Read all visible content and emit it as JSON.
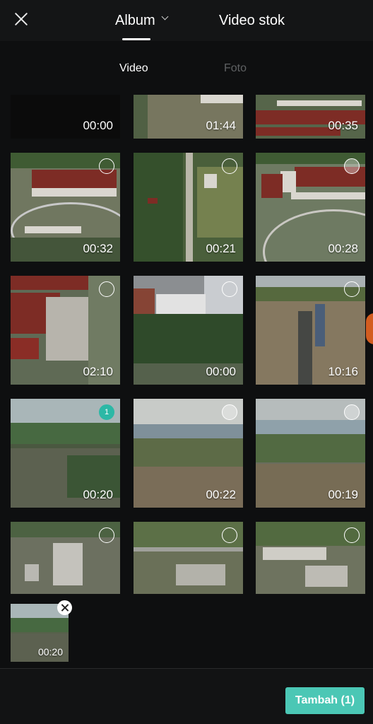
{
  "header": {
    "close_icon": "close-icon",
    "tabs": [
      {
        "label": "Album",
        "active": true,
        "dropdown_icon": "chevron-down-icon"
      },
      {
        "label": "Video stok",
        "active": false
      }
    ]
  },
  "subtabs": [
    {
      "label": "Video",
      "active": true
    },
    {
      "label": "Foto",
      "active": false
    }
  ],
  "grid": {
    "items": [
      {
        "duration": "00:00"
      },
      {
        "duration": "01:44"
      },
      {
        "duration": "00:35"
      },
      {
        "duration": "00:32",
        "selected": false
      },
      {
        "duration": "00:21",
        "selected": false
      },
      {
        "duration": "00:28",
        "selected": false
      },
      {
        "duration": "02:10",
        "selected": false
      },
      {
        "duration": "00:00",
        "selected": false
      },
      {
        "duration": "10:16",
        "selected": false
      },
      {
        "duration": "00:20",
        "selected": true,
        "selection_index": "1"
      },
      {
        "duration": "00:22",
        "selected": false
      },
      {
        "duration": "00:19",
        "selected": false
      },
      {
        "duration": "",
        "selected": false
      },
      {
        "duration": "",
        "selected": false
      },
      {
        "duration": "",
        "selected": false
      }
    ]
  },
  "tray": {
    "items": [
      {
        "duration": "00:20",
        "remove_icon": "close-icon"
      }
    ]
  },
  "footer": {
    "add_label": "Tambah (1)"
  },
  "colors": {
    "accent": "#4bc7b5",
    "selected_badge": "#2cb8a6",
    "background": "#0e0f10"
  }
}
